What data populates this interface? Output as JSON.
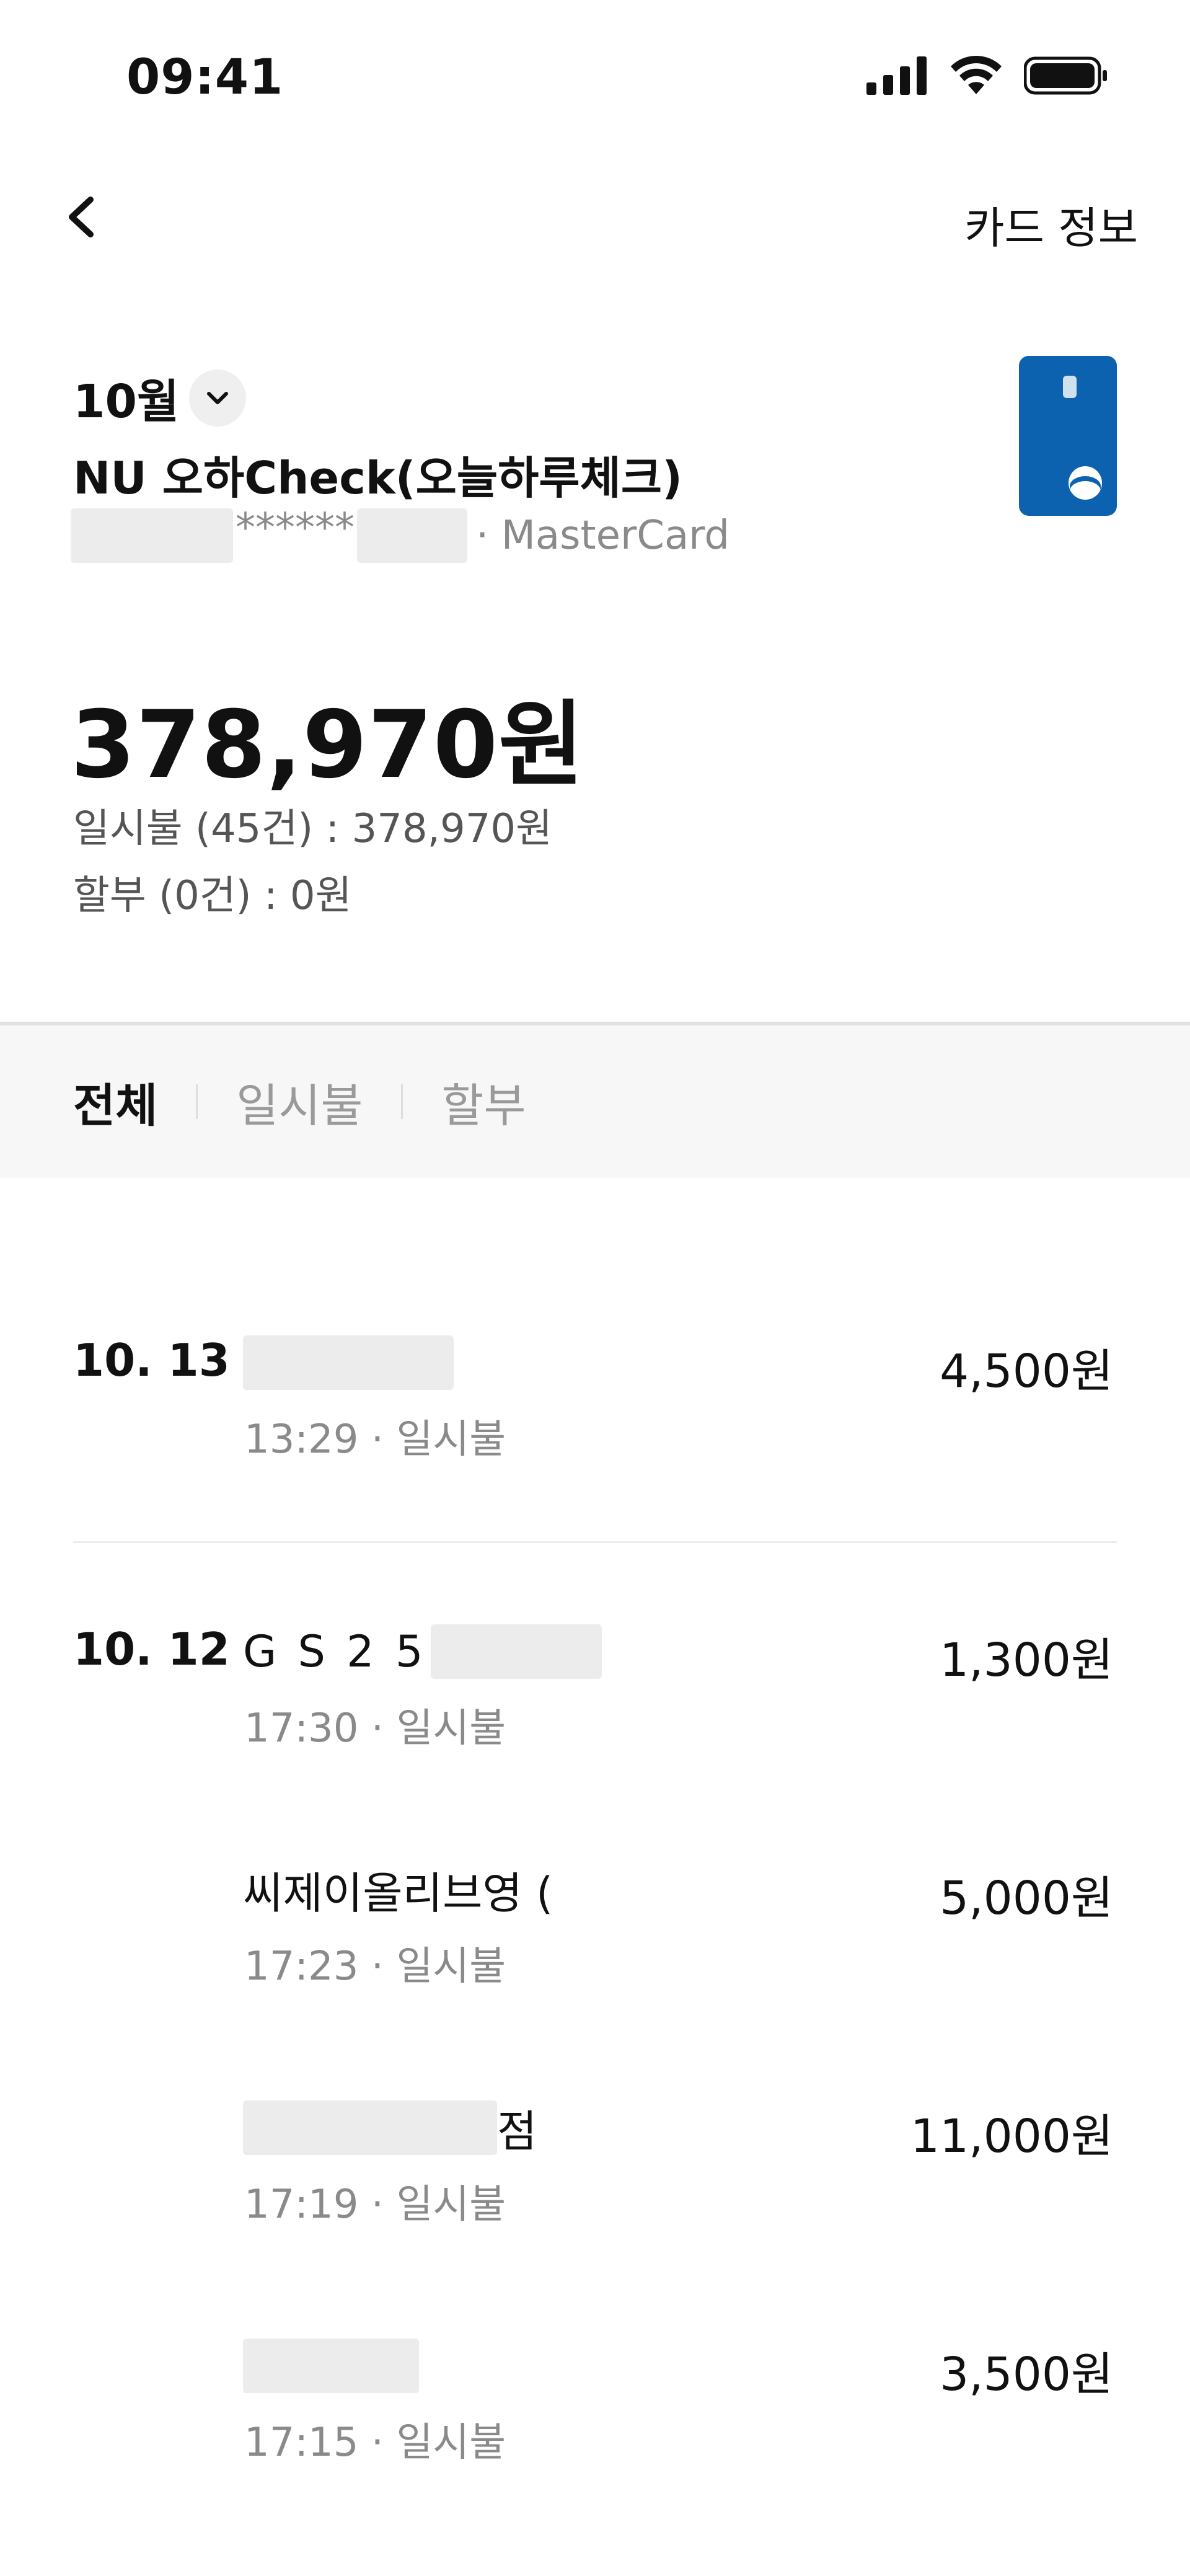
{
  "status_bar": {
    "time": "09:41"
  },
  "nav": {
    "card_info_label": "카드 정보"
  },
  "card": {
    "month_label": "10월",
    "name": "NU 오하Check(오늘하루체크)",
    "number_mask": "******",
    "network": "· MasterCard",
    "color": "#0c62ae"
  },
  "summary": {
    "total": "378,970원",
    "lump_sum_line": "일시불 (45건) : 378,970원",
    "installment_line": "할부 (0건) : 0원"
  },
  "tabs": [
    {
      "label": "전체",
      "active": true
    },
    {
      "label": "일시불",
      "active": false
    },
    {
      "label": "할부",
      "active": false
    }
  ],
  "transactions": [
    {
      "date": "10. 13",
      "merchant": "",
      "time_type": "13:29 · 일시불",
      "amount": "4,500원"
    },
    {
      "date": "10. 12",
      "merchant": "G S 2 5",
      "time_type": "17:30 · 일시불",
      "amount": "1,300원"
    },
    {
      "date": "",
      "merchant": "씨제이올리브영 (",
      "time_type": "17:23 · 일시불",
      "amount": "5,000원"
    },
    {
      "date": "",
      "merchant": "점",
      "time_type": "17:19 · 일시불",
      "amount": "11,000원"
    },
    {
      "date": "",
      "merchant": "",
      "time_type": "17:15 · 일시불",
      "amount": "3,500원"
    }
  ]
}
